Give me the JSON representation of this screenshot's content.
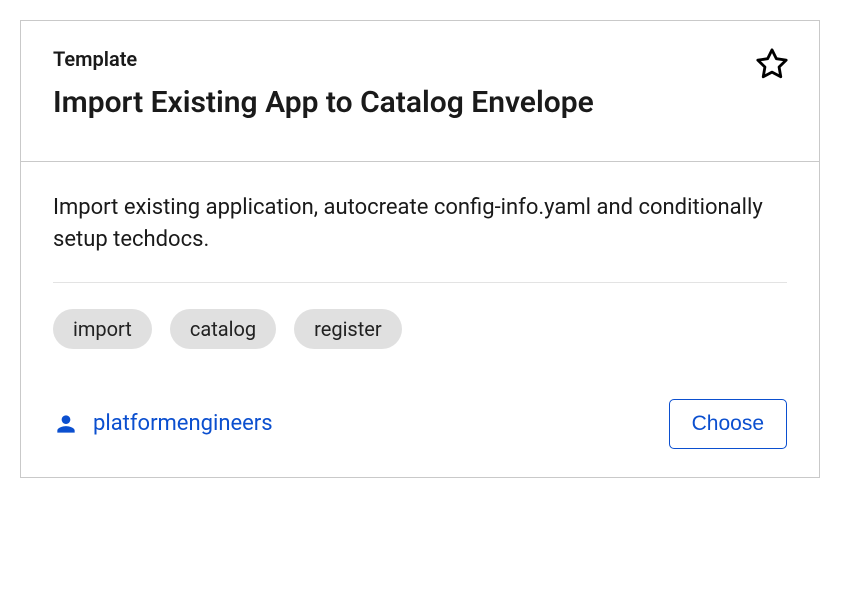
{
  "card": {
    "type_label": "Template",
    "title": "Import Existing App to Catalog Envelope",
    "description": "Import existing application, autocreate config-info.yaml and conditionally setup techdocs.",
    "tags": [
      "import",
      "catalog",
      "register"
    ],
    "owner": "platformengineers",
    "choose_label": "Choose"
  }
}
